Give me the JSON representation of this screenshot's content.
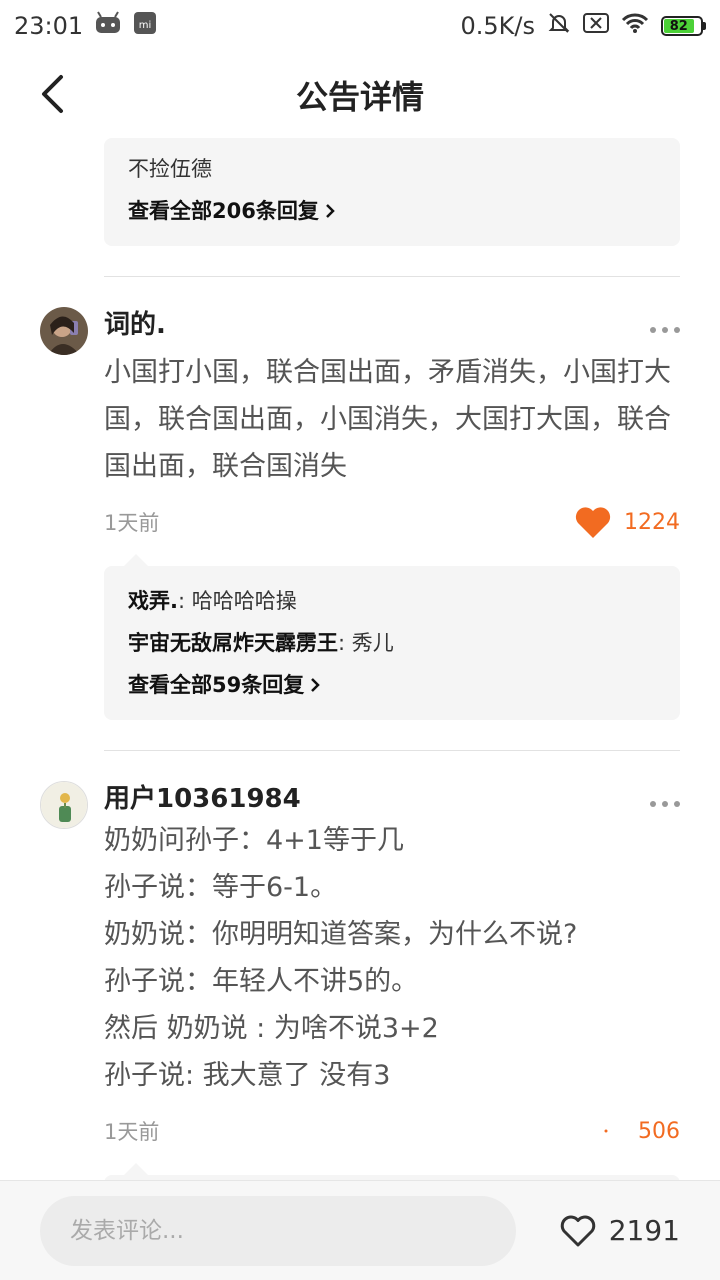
{
  "status_bar": {
    "time": "23:01",
    "net_speed": "0.5K/s",
    "battery": "82"
  },
  "header": {
    "title": "公告详情"
  },
  "top_reply_box": {
    "line": "不捡伍德",
    "more": "查看全部206条回复"
  },
  "comments": [
    {
      "name": "词的.",
      "text": "小国打小国，联合国出面，矛盾消失，小国打大国，联合国出面，小国消失，大国打大国，联合国出面，联合国消失",
      "time": "1天前",
      "likes": "1224",
      "replies": [
        {
          "user": "戏弄.",
          "text": ": 哈哈哈哈操"
        },
        {
          "user": "宇宙无敌屌炸天霹雳王",
          "text": ": 秀儿"
        }
      ],
      "more": "查看全部59条回复"
    },
    {
      "name": "用户10361984",
      "lines": [
        "奶奶问孙子：4+1等于几",
        "孙子说：等于6-1。",
        "奶奶说：你明明知道答案，为什么不说?",
        "孙子说：年轻人不讲5的。",
        "然后 奶奶说 : 为啥不说3+2",
        "孙子说: 我大意了 没有3"
      ],
      "time": "1天前",
      "likes": "506"
    }
  ],
  "bottom": {
    "placeholder": "发表评论...",
    "total_likes": "2191"
  },
  "colors": {
    "accent": "#f26b21",
    "reply_bg": "#f5f5f5"
  }
}
